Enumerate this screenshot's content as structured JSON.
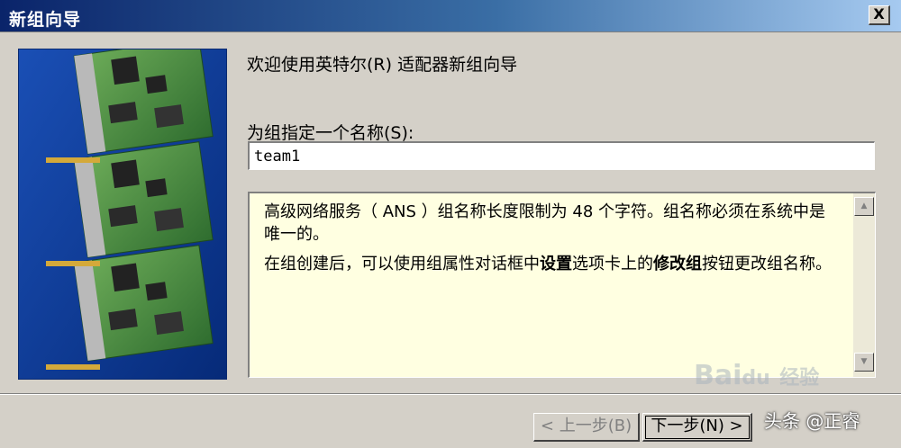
{
  "window": {
    "title": "新组向导",
    "close_label": "X"
  },
  "welcome_text": "欢迎使用英特尔(R) 适配器新组向导",
  "name_field": {
    "label": "为组指定一个名称(S):",
    "value": "team1"
  },
  "info": {
    "paragraph1": "高级网络服务（ ANS ）组名称长度限制为 48 个字符。组名称必须在系统中是唯一的。",
    "p2_part1": "在组创建后，可以使用组属性对话框中",
    "p2_bold1": "设置",
    "p2_part2": "选项卡上的",
    "p2_bold2": "修改组",
    "p2_part3": "按钮更改组名称。"
  },
  "scrollbar": {
    "up_icon": "triangle-up-icon",
    "down_icon": "triangle-down-icon"
  },
  "buttons": {
    "back_label": "< 上一步(B)",
    "next_label": "下一步(N) >"
  },
  "watermark": {
    "brand": "Bai",
    "brand_suffix": "du",
    "cn": "经验"
  },
  "author": "头条 @正睿",
  "colors": {
    "titlebar_start": "#0a246a",
    "titlebar_end": "#a6caf0",
    "info_background": "#ffffe1",
    "dialog_background": "#d4d0c8"
  }
}
